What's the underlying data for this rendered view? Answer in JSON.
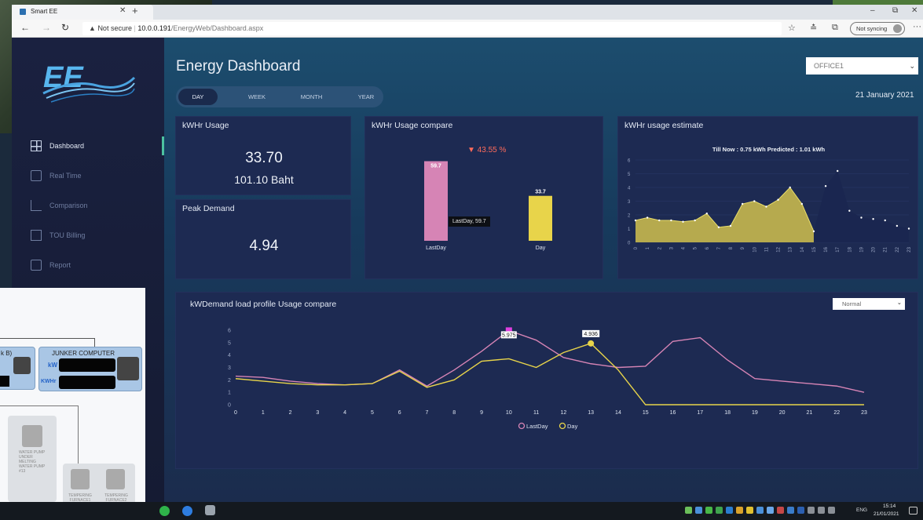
{
  "browser": {
    "tab_title": "Smart EE",
    "security_label": "Not secure",
    "url_host": "10.0.0.191",
    "url_path": "/EnergyWeb/Dashboard.aspx",
    "sync_label": "Not syncing"
  },
  "sidebar": {
    "items": [
      {
        "label": "Dashboard",
        "icon": "dashboard-icon"
      },
      {
        "label": "Real Time",
        "icon": "realtime-icon"
      },
      {
        "label": "Comparison",
        "icon": "comparison-icon"
      },
      {
        "label": "TOU Billing",
        "icon": "billing-icon"
      },
      {
        "label": "Report",
        "icon": "report-icon"
      }
    ]
  },
  "header": {
    "title": "Energy Dashboard",
    "location": "OFFICE1",
    "date": "21 January 2021",
    "period_tabs": [
      "DAY",
      "WEEK",
      "MONTH",
      "YEAR"
    ]
  },
  "usage_card": {
    "title": "kWHr Usage",
    "kwh": "33.70",
    "baht": "101.10 Baht"
  },
  "peak_card": {
    "title": "Peak Demand",
    "value": "4.94"
  },
  "compare_card": {
    "title": "kWHr Usage compare",
    "change": "▼ 43.55 %",
    "tooltip": "LastDay, 59.7"
  },
  "estimate_card": {
    "title": "kWHr usage estimate",
    "summary": "Till Now : 0.75 kWh Predicted : 1.01 kWh"
  },
  "profile_card": {
    "title": "kWDemand load profile Usage compare",
    "mode": "Normal",
    "peak_lastday_label": "5.975",
    "peak_day_label": "4.936"
  },
  "diagram": {
    "left_fragment": "k B)",
    "computer_title": "JUNKER COMPUTER",
    "kw": "kW",
    "kwhr": "KWHr",
    "pump_label": "WATER PUMP UNDER MELTING WATER PUMP #13",
    "furnace1": "TEMPERING FURNACE1",
    "furnace2": "TEMPERING FURNACE2"
  },
  "taskbar": {
    "time": "15:14",
    "date": "21/01/2021",
    "lang": "ENG"
  },
  "colors": {
    "lastday": "#d684b5",
    "day": "#e8d44a",
    "accent": "#ff6b5b"
  },
  "chart_data": [
    {
      "type": "bar",
      "categories": [
        "LastDay",
        "Day"
      ],
      "values": [
        59.7,
        33.7
      ],
      "value_labels": [
        "59.7",
        "33.7"
      ]
    },
    {
      "type": "area",
      "x": [
        "0",
        "1",
        "2",
        "3",
        "4",
        "5",
        "6",
        "7",
        "8",
        "9",
        "10",
        "11",
        "12",
        "13",
        "14",
        "15",
        "16",
        "17",
        "18",
        "19",
        "20",
        "21",
        "22",
        "23"
      ],
      "actual": [
        1.6,
        1.8,
        1.6,
        1.6,
        1.5,
        1.6,
        2.1,
        1.1,
        1.2,
        2.8,
        3.0,
        2.6,
        3.1,
        4.0,
        2.8,
        0.8
      ],
      "predicted": [
        4.1,
        5.2,
        2.3,
        1.8,
        1.7,
        1.6,
        1.2,
        1.0
      ],
      "ylim": [
        0,
        6
      ],
      "yticks": [
        "0",
        "1",
        "2",
        "3",
        "4",
        "5",
        "6"
      ]
    },
    {
      "type": "line",
      "x": [
        "0",
        "1",
        "2",
        "3",
        "4",
        "5",
        "6",
        "7",
        "8",
        "9",
        "10",
        "11",
        "12",
        "13",
        "14",
        "15",
        "16",
        "17",
        "18",
        "19",
        "20",
        "21",
        "22",
        "23"
      ],
      "series": [
        {
          "name": "LastDay",
          "values": [
            2.3,
            2.2,
            1.9,
            1.7,
            1.6,
            1.7,
            2.8,
            1.5,
            2.8,
            4.3,
            5.975,
            5.2,
            3.8,
            3.3,
            3.0,
            3.1,
            5.1,
            5.4,
            3.6,
            2.1,
            1.9,
            1.7,
            1.5,
            1.0
          ]
        },
        {
          "name": "Day",
          "values": [
            2.1,
            1.9,
            1.7,
            1.6,
            1.6,
            1.7,
            2.7,
            1.4,
            2.0,
            3.5,
            3.7,
            3.0,
            4.2,
            4.936,
            2.8,
            0,
            0,
            0,
            0,
            0,
            0,
            0,
            0,
            0
          ]
        }
      ],
      "ylim": [
        0,
        6
      ],
      "yticks": [
        "0",
        "1",
        "2",
        "3",
        "4",
        "5",
        "6"
      ]
    }
  ]
}
